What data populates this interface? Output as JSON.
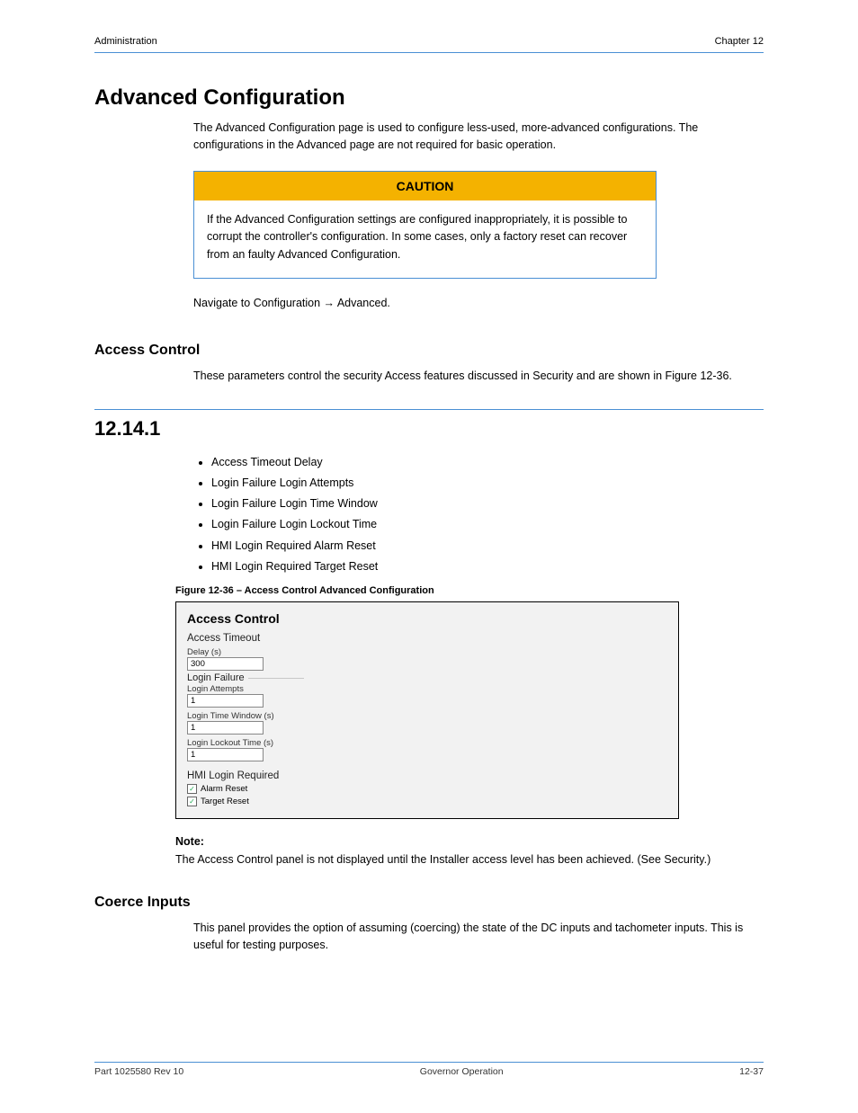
{
  "header": {
    "left": "Administration",
    "right": "Chapter 12"
  },
  "intro": {
    "title": "Advanced Configuration",
    "p1": "The Advanced Configuration page is used to configure less-used, more-advanced configurations. The configurations in the Advanced page are not required for basic operation.",
    "caution_title": "CAUTION",
    "caution_body": "If the Advanced Configuration settings are configured inappropriately, it is possible to corrupt the controller's configuration. In some cases, only a factory reset can recover from an faulty Advanced Configuration.",
    "p2": "Navigate to Configuration → Advanced."
  },
  "access": {
    "heading": "Access Control",
    "section_num": "12.14.1",
    "desc": "These parameters control the security Access features discussed in Security and are shown in Figure 12-36.",
    "bullets": [
      "Access Timeout Delay",
      "Login Failure Login Attempts",
      "Login Failure Login Time Window",
      "Login Failure Login Lockout Time",
      "HMI Login Required Alarm Reset",
      "HMI Login Required Target Reset"
    ],
    "fig_caption": "Figure 12-36 – Access Control Advanced Configuration"
  },
  "panel": {
    "title": "Access Control",
    "timeout": {
      "sub": "Access Timeout",
      "lbl": "Delay (s)",
      "val": "300"
    },
    "failure": {
      "sub": "Login Failure",
      "attempts_lbl": "Login Attempts",
      "attempts_val": "1",
      "window_lbl": "Login Time Window (s)",
      "window_val": "1",
      "lockout_lbl": "Login Lockout Time (s)",
      "lockout_val": "1"
    },
    "hmi": {
      "sub": "HMI Login Required",
      "alarm": "Alarm Reset",
      "target": "Target Reset"
    }
  },
  "note": {
    "label": "Note:",
    "body": "The Access Control panel is not displayed until the Installer access level has been achieved. (See Security.)"
  },
  "coerce": {
    "heading": "Coerce Inputs",
    "desc": "This panel provides the option of assuming (coercing) the state of the DC inputs and tachometer inputs. This is useful for testing purposes."
  },
  "footer": {
    "left": "Part 1025580 Rev 10",
    "center": "Governor Operation",
    "right": "12-37"
  }
}
